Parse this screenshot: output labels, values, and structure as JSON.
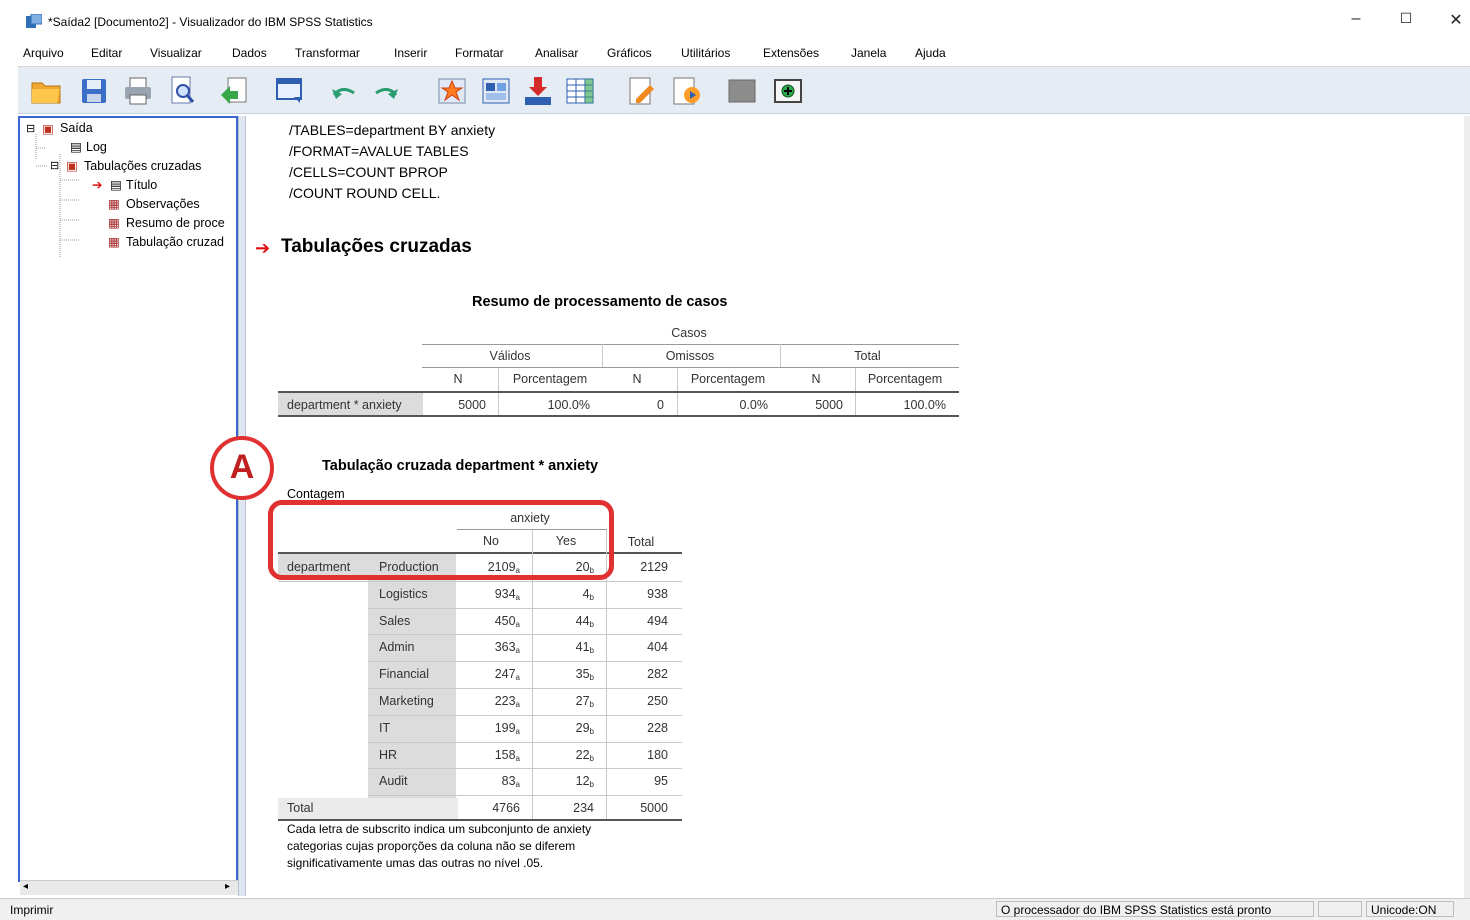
{
  "window": {
    "title": "*Saída2 [Documento2] - Visualizador do IBM SPSS Statistics",
    "minimize": "–",
    "maximize": "☐",
    "close": "✕"
  },
  "menu": [
    "Arquivo",
    "Editar",
    "Visualizar",
    "Dados",
    "Transformar",
    "Inserir",
    "Formatar",
    "Analisar",
    "Gráficos",
    "Utilitários",
    "Extensões",
    "Janela",
    "Ajuda"
  ],
  "toolbar_icons": [
    "open-icon",
    "save-icon",
    "print-icon",
    "print-preview-icon",
    "export-icon",
    "recall-dialog-icon",
    "undo-icon",
    "redo-icon",
    "goto-case-icon",
    "goto-variable-icon",
    "insert-variable-icon",
    "split-icon",
    "edit-icon",
    "insert-chart-icon",
    "designate-window-icon",
    "add-icon"
  ],
  "tree": {
    "root": "Saída",
    "log": "Log",
    "crosstabs": "Tabulações cruzadas",
    "title_item": "Título",
    "notes": "Observações",
    "summary": "Resumo de proce",
    "crosstab": "Tabulação cruzad"
  },
  "syntax": [
    "/TABLES=department BY anxiety",
    "/FORMAT=AVALUE TABLES",
    "/CELLS=COUNT BPROP",
    "/COUNT ROUND CELL."
  ],
  "section_title": "Tabulações cruzadas",
  "summary_table": {
    "title": "Resumo de processamento de casos",
    "casos": "Casos",
    "validos": "Válidos",
    "omissos": "Omissos",
    "total": "Total",
    "n": "N",
    "pct": "Porcentagem",
    "row_label": "department * anxiety",
    "valid_n": "5000",
    "valid_pct": "100.0%",
    "missing_n": "0",
    "missing_pct": "0.0%",
    "total_n": "5000",
    "total_pct": "100.0%"
  },
  "crosstab": {
    "title": "Tabulação cruzada department * anxiety",
    "contagem": "Contagem",
    "anxiety": "anxiety",
    "no": "No",
    "yes": "Yes",
    "total": "Total",
    "department": "department",
    "rows": [
      {
        "label": "Production",
        "no": "2109",
        "no_sub": "a",
        "yes": "20",
        "yes_sub": "b",
        "total": "2129"
      },
      {
        "label": "Logistics",
        "no": "934",
        "no_sub": "a",
        "yes": "4",
        "yes_sub": "b",
        "total": "938"
      },
      {
        "label": "Sales",
        "no": "450",
        "no_sub": "a",
        "yes": "44",
        "yes_sub": "b",
        "total": "494"
      },
      {
        "label": "Admin",
        "no": "363",
        "no_sub": "a",
        "yes": "41",
        "yes_sub": "b",
        "total": "404"
      },
      {
        "label": "Financial",
        "no": "247",
        "no_sub": "a",
        "yes": "35",
        "yes_sub": "b",
        "total": "282"
      },
      {
        "label": "Marketing",
        "no": "223",
        "no_sub": "a",
        "yes": "27",
        "yes_sub": "b",
        "total": "250"
      },
      {
        "label": "IT",
        "no": "199",
        "no_sub": "a",
        "yes": "29",
        "yes_sub": "b",
        "total": "228"
      },
      {
        "label": "HR",
        "no": "158",
        "no_sub": "a",
        "yes": "22",
        "yes_sub": "b",
        "total": "180"
      },
      {
        "label": "Audit",
        "no": "83",
        "no_sub": "a",
        "yes": "12",
        "yes_sub": "b",
        "total": "95"
      }
    ],
    "total_label": "Total",
    "total_no": "4766",
    "total_yes": "234",
    "total_total": "5000",
    "footnote": [
      "Cada letra de subscrito indica um subconjunto de anxiety",
      "categorias cujas proporções da coluna não se diferem",
      "significativamente umas das outras no nível .05."
    ]
  },
  "annotation": {
    "label": "A",
    "color": "#e03030"
  },
  "status": {
    "left": "Imprimir",
    "processor": "O processador do IBM SPSS Statistics  está pronto",
    "unicode": "Unicode:ON"
  }
}
